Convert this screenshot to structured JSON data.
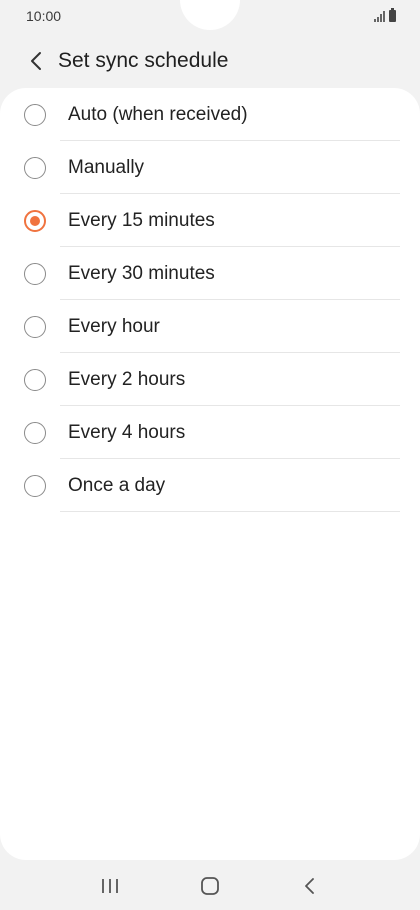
{
  "status_bar": {
    "time": "10:00",
    "icons": [
      "signal-icon",
      "battery-icon"
    ]
  },
  "header": {
    "back_icon": "chevron-left-icon",
    "title": "Set sync schedule"
  },
  "options": [
    {
      "label": "Auto (when received)",
      "selected": false
    },
    {
      "label": "Manually",
      "selected": false
    },
    {
      "label": "Every 15 minutes",
      "selected": true
    },
    {
      "label": "Every 30 minutes",
      "selected": false
    },
    {
      "label": "Every hour",
      "selected": false
    },
    {
      "label": "Every 2 hours",
      "selected": false
    },
    {
      "label": "Every 4 hours",
      "selected": false
    },
    {
      "label": "Once a day",
      "selected": false
    }
  ],
  "nav_bar": {
    "items": [
      "recents-icon",
      "home-icon",
      "back-icon"
    ]
  },
  "colors": {
    "accent": "#f0733f",
    "background": "#f2f2f2",
    "card": "#ffffff"
  }
}
